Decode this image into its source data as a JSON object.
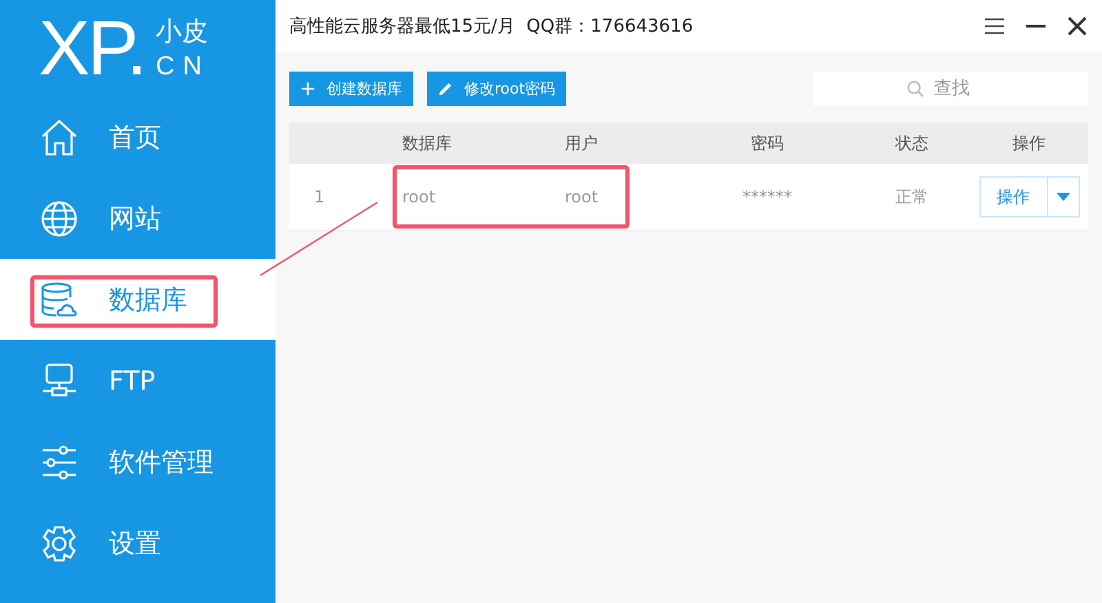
{
  "logo": {
    "main": "XP.",
    "top": "小皮",
    "bottom": "CN"
  },
  "sidebar": {
    "items": [
      {
        "label": "首页",
        "selected": false,
        "highlighted": false
      },
      {
        "label": "网站",
        "selected": false,
        "highlighted": false
      },
      {
        "label": "数据库",
        "selected": true,
        "highlighted": true
      },
      {
        "label": "FTP",
        "selected": false,
        "highlighted": false
      },
      {
        "label": "软件管理",
        "selected": false,
        "highlighted": false
      },
      {
        "label": "设置",
        "selected": false,
        "highlighted": false
      }
    ]
  },
  "header": {
    "notice": "高性能云服务器最低15元/月  QQ群：176643616"
  },
  "toolbar": {
    "buttons": [
      {
        "label": "创建数据库"
      },
      {
        "label": "修改root密码"
      }
    ],
    "search": {
      "placeholder": "查找"
    }
  },
  "table": {
    "columns": [
      "数据库",
      "用户",
      "密码",
      "状态",
      "操作"
    ],
    "rows": [
      {
        "index": "1",
        "database": "root",
        "user": "root",
        "password": "******",
        "status": "正常",
        "action": "操作",
        "highlighted": true
      }
    ]
  }
}
